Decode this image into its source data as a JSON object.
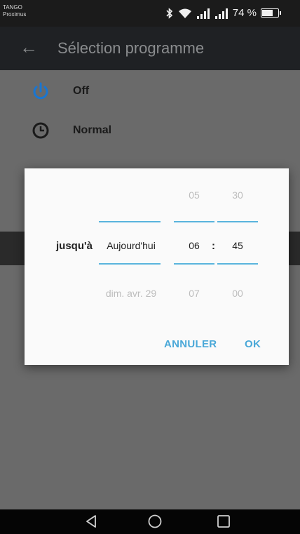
{
  "status_bar": {
    "carrier_line1": "TANGO",
    "carrier_line2": "Proximus",
    "battery_percent": "74 %",
    "battery_level": 0.74
  },
  "app_bar": {
    "back_icon": "arrow-left-icon",
    "title": "Sélection programme"
  },
  "program_list": [
    {
      "label": "Off",
      "icon": "power-icon",
      "icon_color": "#1976d2"
    },
    {
      "label": "Normal",
      "icon": "clock-icon",
      "icon_color": "#1a1a1a"
    }
  ],
  "dialog": {
    "label": "jusqu'à",
    "date_picker": {
      "above": "",
      "selected": "Aujourd'hui",
      "below": "dim. avr. 29"
    },
    "hour_picker": {
      "above": "05",
      "selected": "06",
      "below": "07"
    },
    "separator": ":",
    "minute_picker": {
      "above": "30",
      "selected": "45",
      "below": "00"
    },
    "cancel_label": "ANNULER",
    "ok_label": "OK",
    "accent_color": "#4aa8d8"
  },
  "nav_bar": {
    "back_icon": "triangle-back-icon",
    "home_icon": "circle-home-icon",
    "recents_icon": "square-recents-icon"
  }
}
